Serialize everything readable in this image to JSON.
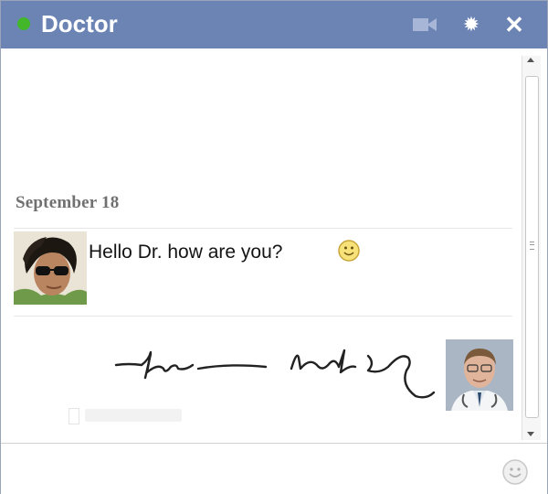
{
  "window": {
    "title": "Doctor",
    "status": "online",
    "status_color": "#42b72a",
    "titlebar_color": "#6b84b4",
    "icons": [
      "video-icon",
      "gear-icon",
      "close-icon"
    ]
  },
  "conversation": {
    "date_label": "September 18",
    "messages": [
      {
        "sender": "user",
        "type": "text",
        "text": "Hello Dr. how are you?",
        "icons": [
          "smiley-icon"
        ]
      },
      {
        "sender": "doctor",
        "type": "handwriting"
      }
    ]
  },
  "composer": {
    "icons": [
      "smiley-icon"
    ]
  },
  "icon_glyphs": {
    "gear": "✹",
    "close": "✕"
  }
}
